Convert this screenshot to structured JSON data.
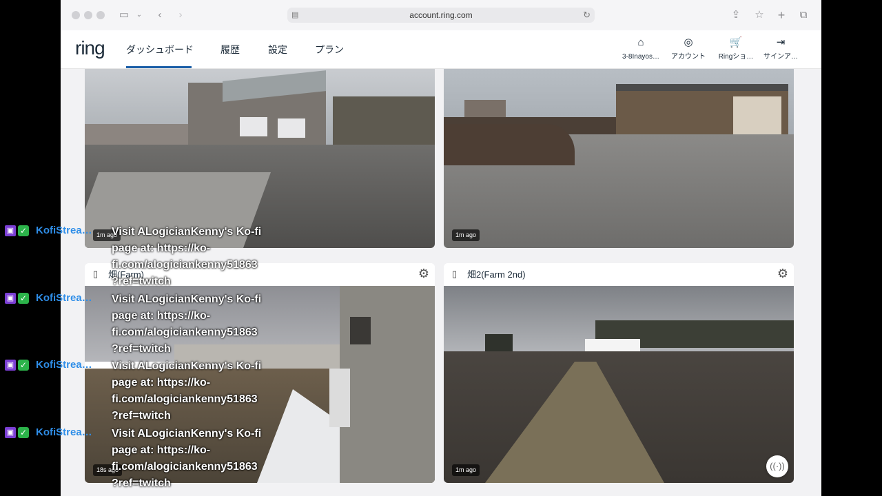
{
  "browser": {
    "url": "account.ring.com"
  },
  "nav": {
    "logo": "ring",
    "tabs": [
      "ダッシュボード",
      "履歴",
      "設定",
      "プラン"
    ],
    "right": [
      {
        "icon": "home-icon",
        "label": "3-8Inayos…"
      },
      {
        "icon": "account-icon",
        "label": "アカウント"
      },
      {
        "icon": "cart-icon",
        "label": "Ringショ…"
      },
      {
        "icon": "signout-icon",
        "label": "サインア…"
      }
    ]
  },
  "cameras": [
    {
      "name": "",
      "ago": "1m ago"
    },
    {
      "name": "",
      "ago": "1m ago"
    },
    {
      "name": "畑(Farm)",
      "ago": "18s ago"
    },
    {
      "name": "畑2(Farm 2nd)",
      "ago": "1m ago"
    }
  ],
  "overlay": {
    "user": "KofiStrea…",
    "messages": [
      "Visit ALogicianKenny's Ko-fi\npage at: https://ko-\nfi.com/alogiciankenny51863\n?ref=twitch",
      "Visit ALogicianKenny's Ko-fi\npage at: https://ko-\nfi.com/alogiciankenny51863\n?ref=twitch",
      "Visit ALogicianKenny's Ko-fi\npage at: https://ko-\nfi.com/alogiciankenny51863\n?ref=twitch",
      "Visit ALogicianKenny's Ko-fi\npage at: https://ko-\nfi.com/alogiciankenny51863\n?ref=twitch"
    ]
  },
  "colors": {
    "accent": "#1c5fa8",
    "twitch": "#7b3fd4",
    "kofi_user": "#2f8ee8"
  }
}
